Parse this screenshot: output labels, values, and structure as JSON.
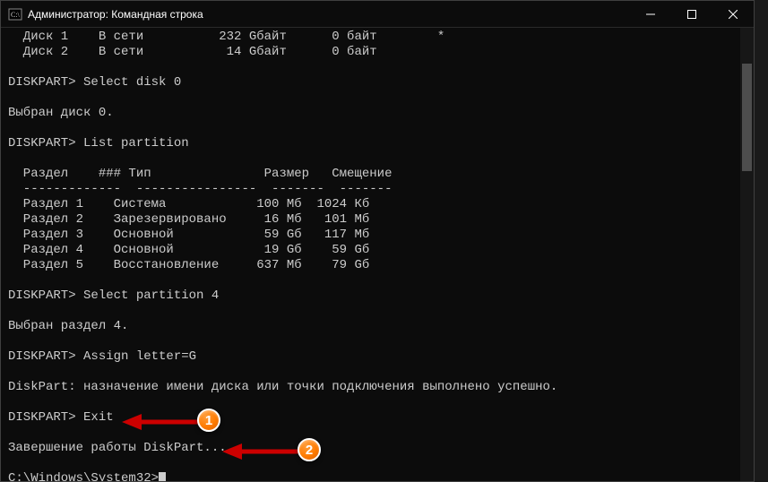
{
  "window": {
    "title": "Администратор: Командная строка"
  },
  "terminal": {
    "lines": {
      "l0": "  Диск 1    В сети          232 Gбайт      0 байт        *",
      "l1": "  Диск 2    В сети           14 Gбайт      0 байт",
      "l2": "",
      "l3": "DISKPART> Select disk 0",
      "l4": "",
      "l5": "Выбран диск 0.",
      "l6": "",
      "l7": "DISKPART> List partition",
      "l8": "",
      "l9": "  Раздел    ### Тип               Размер   Смещение",
      "l10": "  -------------  ----------------  -------  -------",
      "l11": "  Раздел 1    Система            100 Mб  1024 Кб",
      "l12": "  Раздел 2    Зарезервировано     16 Мб   101 Мб",
      "l13": "  Раздел 3    Основной            59 Gб   117 Мб",
      "l14": "  Раздел 4    Основной            19 Gб    59 Gб",
      "l15": "  Раздел 5    Восстановление     637 Мб    79 Gб",
      "l16": "",
      "l17": "DISKPART> Select partition 4",
      "l18": "",
      "l19": "Выбран раздел 4.",
      "l20": "",
      "l21": "DISKPART> Assign letter=G",
      "l22": "",
      "l23": "DiskPart: назначение имени диска или точки подключения выполнено успешно.",
      "l24": "",
      "l25": "DISKPART> Exit",
      "l26": "",
      "l27": "Завершение работы DiskPart...",
      "l28": "",
      "l29": "C:\\Windows\\System32>"
    }
  },
  "annotations": {
    "badge1": "1",
    "badge2": "2"
  }
}
